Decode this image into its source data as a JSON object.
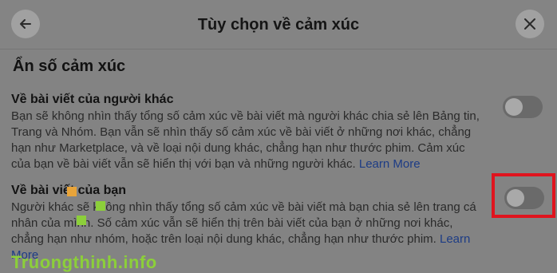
{
  "header": {
    "title": "Tùy chọn về cảm xúc",
    "back_icon": "arrow-left-icon",
    "close_icon": "close-icon"
  },
  "section": {
    "title": "Ẩn số cảm xúc"
  },
  "items": [
    {
      "title": "Về bài viết của người khác",
      "desc_lines": [
        "Bạn sẽ không nhìn thấy tổng số cảm xúc về bài viết mà người khác chia sẻ lên Bảng tin,",
        "Trang và Nhóm. Bạn vẫn sẽ nhìn thấy số cảm xúc về bài viết ở những nơi khác, chẳng",
        "hạn như Marketplace, và về loại nội dung khác, chẳng hạn như thước phim. Cảm xúc",
        "của bạn về bài viết vẫn sẽ hiển thị với bạn và những người khác. "
      ],
      "learn_more": "Learn More",
      "toggle_on": false
    },
    {
      "title": "Về bài viết của bạn",
      "desc_lines": [
        "Người khác sẽ không nhìn thấy tổng số cảm xúc về bài viết mà bạn chia sẻ lên trang cá",
        "nhân của mình. Số cảm xúc vẫn sẽ hiển thị trên bài viết của bạn ở những nơi khác,",
        "chẳng hạn như nhóm, hoặc trên loại nội dung khác, chẳng hạn như thước phim. "
      ],
      "learn_more_a": "Learn",
      "learn_more_b": "More",
      "toggle_on": false
    }
  ],
  "watermark": "Truongthinh.info",
  "colors": {
    "highlight": "#e0141e",
    "link": "#1d3c85",
    "watermark": "#8ccf3a"
  }
}
